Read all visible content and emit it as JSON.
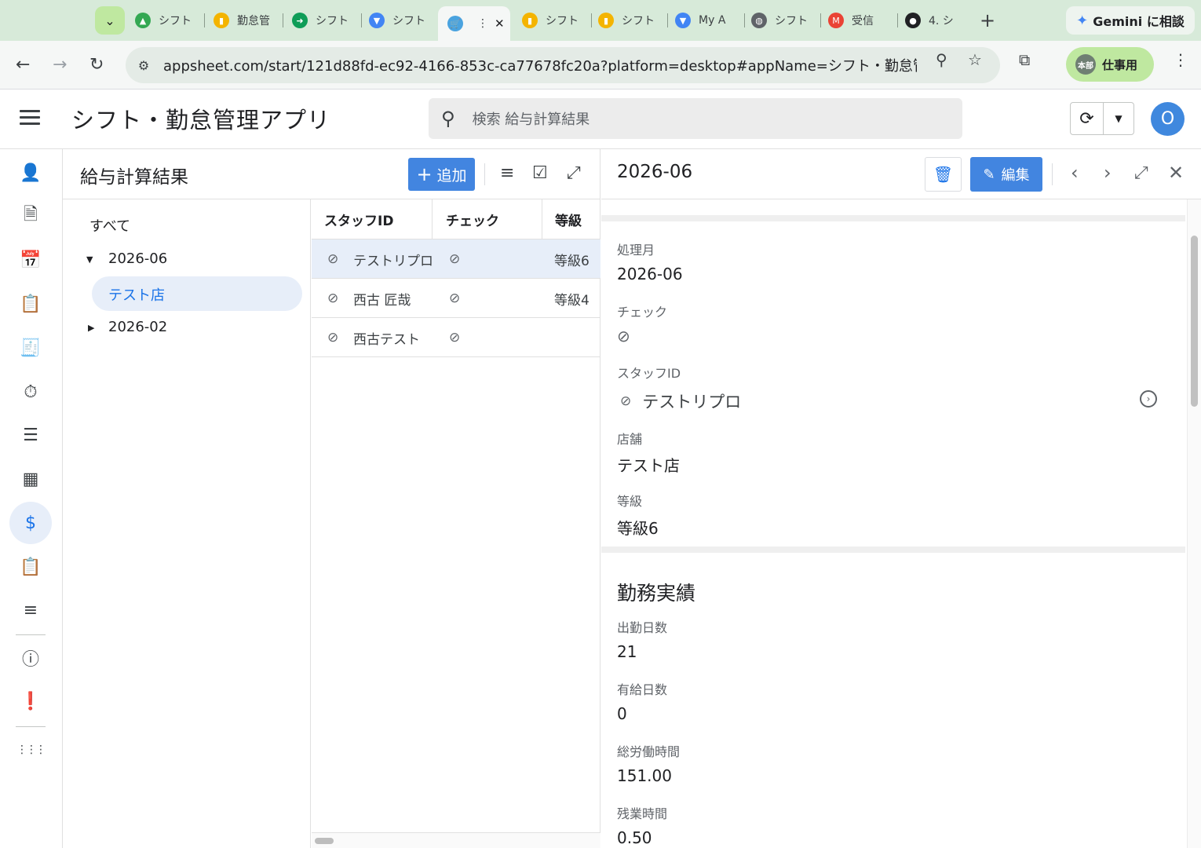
{
  "browser": {
    "tabs": [
      {
        "label": "シフト",
        "fav_color": "#34a853",
        "fav_glyph": "▲"
      },
      {
        "label": "勤怠管",
        "fav_color": "#f4b400",
        "fav_glyph": "▮"
      },
      {
        "label": "シフト",
        "fav_color": "#0f9d58",
        "fav_glyph": "➜"
      },
      {
        "label": "シフト",
        "fav_color": "#4285f4",
        "fav_glyph": "▼"
      },
      {
        "label": "",
        "fav_color": "#4aa3df",
        "fav_glyph": "🛒",
        "active": true
      },
      {
        "label": "シフト",
        "fav_color": "#f4b400",
        "fav_glyph": "▮"
      },
      {
        "label": "シフト",
        "fav_color": "#f4b400",
        "fav_glyph": "▮"
      },
      {
        "label": "My A",
        "fav_color": "#4285f4",
        "fav_glyph": "▼"
      },
      {
        "label": "シフト",
        "fav_color": "#5f6368",
        "fav_glyph": "◍"
      },
      {
        "label": "受信",
        "fav_color": "#ea4335",
        "fav_glyph": "M"
      },
      {
        "label": "4. シ",
        "fav_color": "#202124",
        "fav_glyph": "●"
      }
    ],
    "gemini_label": "Gemini に相談",
    "url": "appsheet.com/start/121d88fd-ec92-4166-853c-ca77678fc20a?platform=desktop#appName=シフト・勤怠管...",
    "profile_badge": "本部",
    "profile_label": "仕事用"
  },
  "app": {
    "title": "シフト・勤怠管理アプリ",
    "search_placeholder": "検索 給与計算結果",
    "user_initial": "O"
  },
  "rail": {
    "items": [
      {
        "name": "staff-schedule-icon",
        "glyph": "👤"
      },
      {
        "name": "document-icon",
        "glyph": "🗎"
      },
      {
        "name": "calendar-edit-icon",
        "glyph": "📅"
      },
      {
        "name": "clipboard-check-icon",
        "glyph": "📋"
      },
      {
        "name": "invoice-icon",
        "glyph": "🧾"
      },
      {
        "name": "timer-icon",
        "glyph": "⏱"
      },
      {
        "name": "list-icon",
        "glyph": "☰"
      },
      {
        "name": "calculator-icon",
        "glyph": "▦"
      },
      {
        "name": "payroll-icon",
        "glyph": "$",
        "active": true
      },
      {
        "name": "clipboard-list-icon",
        "glyph": "📋"
      },
      {
        "name": "menu-lines-icon",
        "glyph": "≡"
      },
      {
        "name": "info-icon",
        "glyph": "ⓘ"
      },
      {
        "name": "feedback-icon",
        "glyph": "❗"
      },
      {
        "name": "apps-grid-icon",
        "glyph": "⋮⋮⋮"
      }
    ]
  },
  "list": {
    "title": "給与計算結果",
    "add_label": "追加",
    "tree": {
      "all_label": "すべて",
      "groups": [
        {
          "label": "2026-06",
          "expanded": true,
          "children": [
            "テスト店"
          ]
        },
        {
          "label": "2026-02",
          "expanded": false,
          "children": []
        }
      ]
    },
    "columns": [
      "スタッフID",
      "チェック",
      "等級"
    ],
    "rows": [
      {
        "staff": "テストリプロ",
        "grade": "等級6",
        "selected": true
      },
      {
        "staff": "西古 匠哉",
        "grade": "等級4",
        "selected": false
      },
      {
        "staff": "西古テスト",
        "grade": "",
        "selected": false
      }
    ]
  },
  "detail": {
    "title": "2026-06",
    "edit_label": "編集",
    "fields": {
      "month_label": "処理月",
      "month_value": "2026-06",
      "check_label": "チェック",
      "staff_label": "スタッフID",
      "staff_value": "テストリプロ",
      "store_label": "店舗",
      "store_value": "テスト店",
      "grade_label": "等級",
      "grade_value": "等級6"
    },
    "section_work": {
      "title": "勤務実績",
      "workdays_label": "出勤日数",
      "workdays_value": "21",
      "paid_leave_label": "有給日数",
      "paid_leave_value": "0",
      "total_hours_label": "総労働時間",
      "total_hours_value": "151.00",
      "overtime_label": "残業時間",
      "overtime_value": "0.50"
    }
  }
}
